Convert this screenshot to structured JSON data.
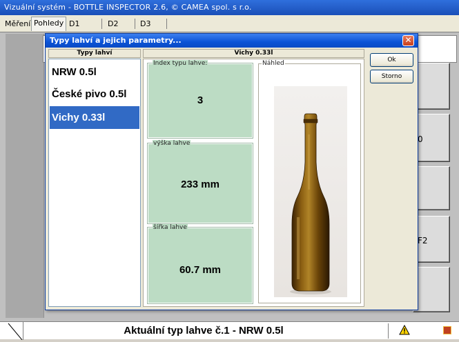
{
  "app": {
    "title": "Vizuální systém - BOTTLE INSPECTOR 2.6, © CAMEA spol. s r.o."
  },
  "tabs": [
    {
      "label": "Měření",
      "active": false
    },
    {
      "label": "Pohledy",
      "active": true
    },
    {
      "label": "D1",
      "active": false
    },
    {
      "label": "D2",
      "active": false
    },
    {
      "label": "D3",
      "active": false
    }
  ],
  "background_buttons": [
    {
      "label": ""
    },
    {
      "label": "0"
    },
    {
      "label": ""
    },
    {
      "label": "F2"
    },
    {
      "label": ""
    }
  ],
  "dialog": {
    "title": "Typy lahví a jejich parametry...",
    "close_glyph": "✕",
    "list_header": "Typy lahví",
    "items": [
      {
        "label": "NRW 0.5l",
        "selected": false
      },
      {
        "label": "České pivo 0.5l",
        "selected": false
      },
      {
        "label": "Vichy 0.33l",
        "selected": true
      }
    ],
    "params_header": "Vichy 0.33l",
    "fields": {
      "index": {
        "label": "Index typu lahve:",
        "value": "3"
      },
      "height": {
        "label": "výška lahve",
        "value": "233 mm"
      },
      "width": {
        "label": "šířka lahve",
        "value": "60.7 mm"
      }
    },
    "preview_label": "Náhled",
    "ok_label": "Ok",
    "cancel_label": "Storno"
  },
  "status": {
    "text": "Aktuální typ lahve č.1 - NRW 0.5l",
    "warning_icon": "warning-icon"
  },
  "colors": {
    "field_bg": "#bcdcc4",
    "selection": "#316ac5",
    "titlebar": "#0b53d6",
    "bottle": "#5a3a08"
  }
}
